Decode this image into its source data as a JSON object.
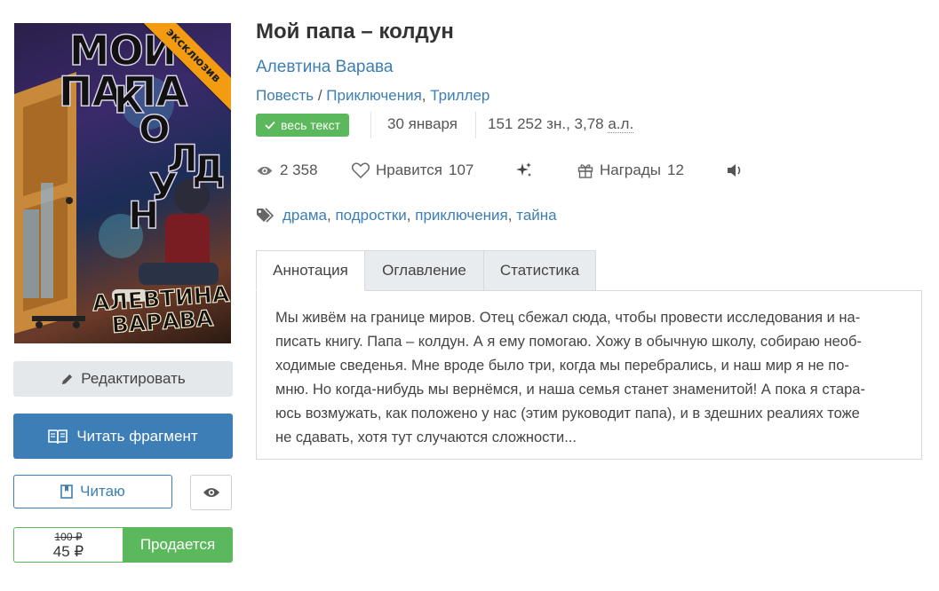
{
  "cover": {
    "title_line1": "МОЙ ПАПА",
    "title_vertical": [
      "К",
      "О",
      "Л",
      "Д",
      "У",
      "Н"
    ],
    "author_line1": "АЛЕВТИНА",
    "author_line2": "ВАРАВА",
    "ribbon": "эксклюзив"
  },
  "actions": {
    "edit_label": "Редактировать",
    "read_fragment_label": "Читать фрагмент",
    "reading_label": "Читаю",
    "old_price": "100 ₽",
    "new_price": "45 ₽",
    "sell_label": "Продается"
  },
  "book": {
    "title": "Мой папа – колдун",
    "author": "Алевтина Варава",
    "genre1": "Повесть",
    "genre_sep": " / ",
    "genre2": "Приключения",
    "genre_comma": ", ",
    "genre3": "Триллер",
    "status_badge": "весь текст",
    "date": "30 января",
    "size_prefix": "151 252 зн., 3,78 ",
    "size_unit": "а.л."
  },
  "stats": {
    "views": "2 358",
    "likes_label": "Нравится",
    "likes": "107",
    "awards_label": "Награды",
    "awards": "12"
  },
  "tags": {
    "t1": "драма",
    "t2": "подростки",
    "t3": "приключения",
    "t4": "тайна",
    "comma": ","
  },
  "tabs": {
    "annotation": "Аннотация",
    "contents": "Оглавление",
    "statistics": "Статистика"
  },
  "annotation_lines": [
    "Мы живём на границе миров. Отец сбежал сюда, чтобы провести исследования и на-",
    "писать книгу. Папа – колдун. А я ему помогаю. Хожу в обычную школу, собираю необ-",
    "ходимые сведенья. Мне вроде было три, когда мы перебрались, и наш мир я не по-",
    "мню. Но когда-нибудь мы вернёмся, и наша семья станет знаменитой! А пока я стара-",
    "юсь возмужать, как положено у нас (этим руководит папа), и в здешних реалиях тоже",
    "не сдавать, хотя тут случаются сложности..."
  ],
  "colors": {
    "accent": "#3c7eb5",
    "success": "#5cb85c",
    "ribbon": "#f39c12"
  }
}
